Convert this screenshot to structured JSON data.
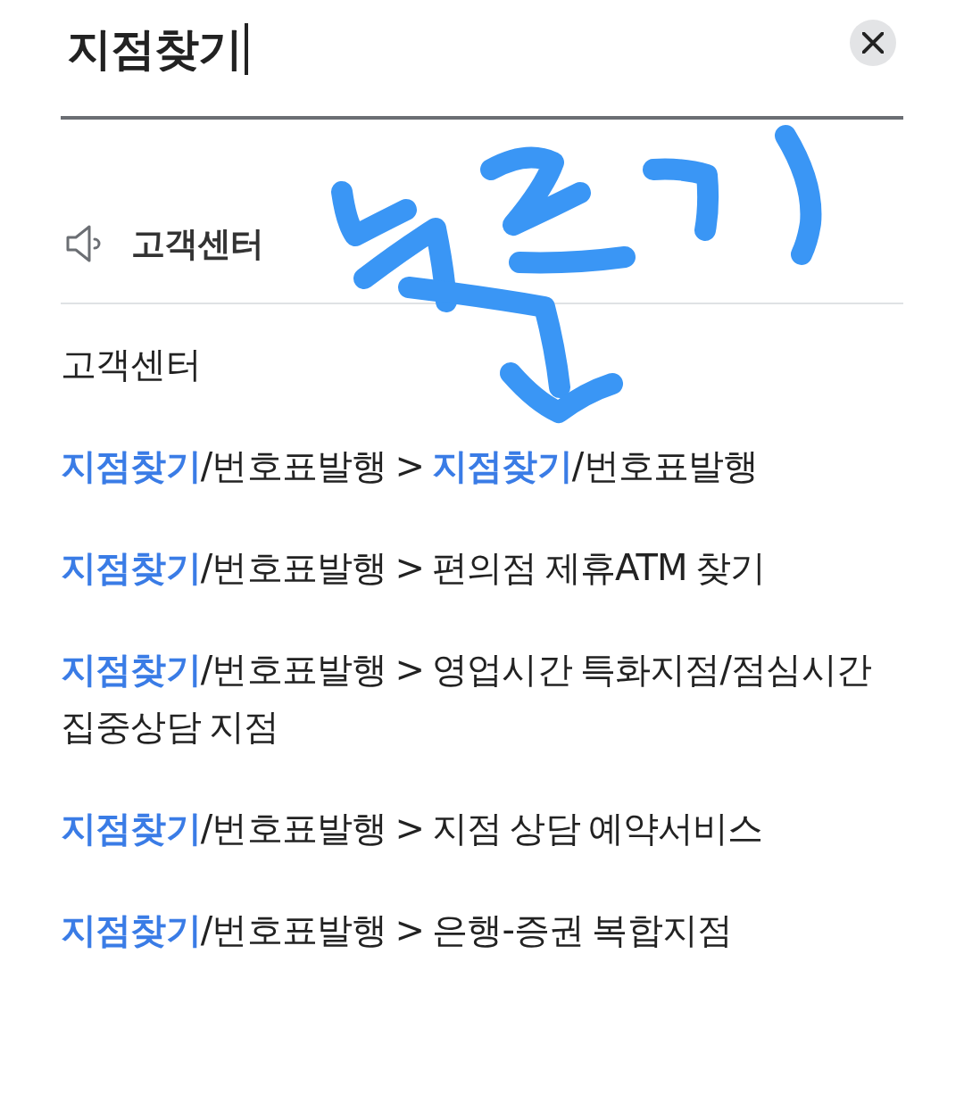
{
  "search": {
    "value": "지점찾기"
  },
  "section": {
    "title": "고객센터"
  },
  "category": "고객센터",
  "results": [
    "**지점찾기**/번호표발행 > **지점찾기**/번호표발행",
    "**지점찾기**/번호표발행 > 편의점 제휴ATM 찾기",
    "**지점찾기**/번호표발행 > 영업시간 특화지점/점심시간 집중상담 지점",
    "**지점찾기**/번호표발행 > 지점 상담 예약서비스",
    "**지점찾기**/번호표발행 > 은행-증권 복합지점"
  ]
}
